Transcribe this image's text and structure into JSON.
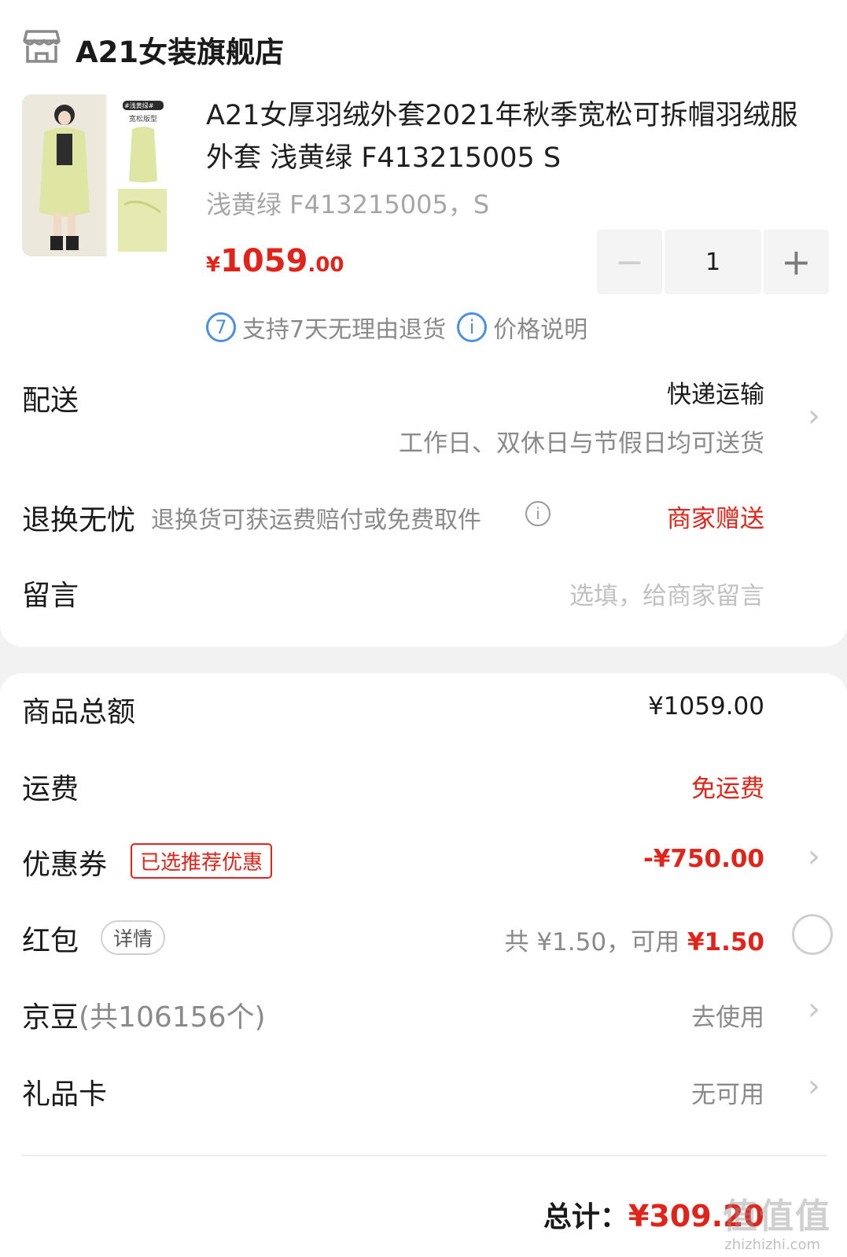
{
  "shop": {
    "name": "A21女装旗舰店",
    "icon": "store-icon"
  },
  "product": {
    "title": "A21女厚羽绒外套2021年秋季宽松可拆帽羽绒服外套 浅黄绿 F413215005 S",
    "spec": "浅黄绿 F413215005，S",
    "image_tag": "#浅黄绿#",
    "image_caption": "宽松版型",
    "price": {
      "currency": "¥",
      "integer": "1059",
      "decimal": ".00"
    },
    "quantity": "1",
    "minus_label": "−",
    "plus_label": "+",
    "badges": [
      {
        "icon_text": "7",
        "label": "支持7天无理由退货"
      },
      {
        "icon_text": "i",
        "label": "价格说明"
      }
    ]
  },
  "delivery": {
    "label": "配送",
    "method": "快递运输",
    "note": "工作日、双休日与节假日均可送货"
  },
  "returns": {
    "label": "退换无忧",
    "desc": "退换货可获运费赔付或免费取件",
    "value": "商家赠送"
  },
  "message": {
    "label": "留言",
    "placeholder": "选填，给商家留言"
  },
  "summary": {
    "goods_total": {
      "label": "商品总额",
      "value": "¥1059.00"
    },
    "shipping": {
      "label": "运费",
      "value": "免运费"
    },
    "coupon": {
      "label": "优惠券",
      "tag": "已选推荐优惠",
      "value": "-¥750.00"
    },
    "red_packet": {
      "label": "红包",
      "tag": "详情",
      "total_text": "共 ¥1.50，可用",
      "available": "¥1.50"
    },
    "jingdou": {
      "label": "京豆",
      "count_text": "(共106156个)",
      "action": "去使用"
    },
    "gift_card": {
      "label": "礼品卡",
      "value": "无可用"
    },
    "total": {
      "label": "总计：",
      "value": "¥309.20"
    }
  },
  "watermark": {
    "text": "值值值",
    "sub": "zhizhizhi.com"
  },
  "colors": {
    "accent_red": "#e2231a",
    "badge_blue": "#4a90e2"
  }
}
